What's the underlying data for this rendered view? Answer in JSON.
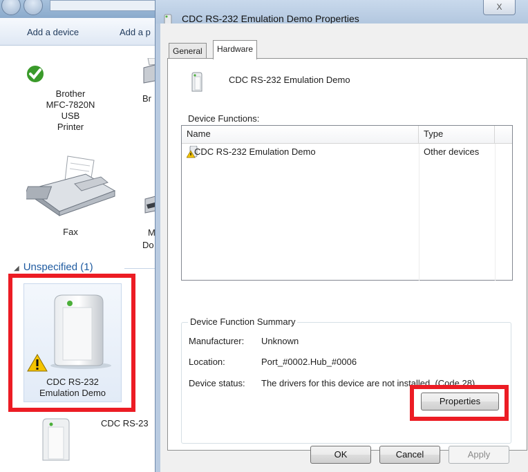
{
  "explorer": {
    "toolbar": {
      "add_device": "Add a device",
      "add_printer_partial": "Add a p"
    },
    "devices": [
      {
        "name_line1": "Brother",
        "name_line2": "MFC-7820N USB",
        "name_line3": "Printer"
      },
      {
        "name_partial": "Br"
      },
      {
        "name": "Fax"
      },
      {
        "name_partial_1": "M",
        "name_partial_2": "Do"
      }
    ],
    "section": {
      "label": "Unspecified (1)"
    },
    "selected_device": {
      "line1": "CDC RS-232",
      "line2": "Emulation Demo"
    },
    "next_device_partial": "CDC RS-23"
  },
  "dialog": {
    "title": "CDC RS-232 Emulation Demo Properties",
    "close_label": "X",
    "tabs": [
      {
        "label": "General"
      },
      {
        "label": "Hardware"
      }
    ],
    "device_name": "CDC RS-232 Emulation Demo",
    "functions_label": "Device Functions:",
    "table": {
      "columns": [
        "Name",
        "Type"
      ],
      "rows": [
        {
          "name": "CDC RS-232 Emulation Demo",
          "type": "Other devices"
        }
      ]
    },
    "summary": {
      "legend": "Device Function Summary",
      "manufacturer_label": "Manufacturer:",
      "manufacturer_value": "Unknown",
      "location_label": "Location:",
      "location_value": "Port_#0002.Hub_#0006",
      "status_label": "Device status:",
      "status_value": "The drivers for this device are not installed. (Code 28)"
    },
    "properties_button": "Properties",
    "buttons": {
      "ok": "OK",
      "cancel": "Cancel",
      "apply": "Apply"
    }
  },
  "colors": {
    "highlight_box": "#ec1c24",
    "link_blue": "#1e5aa0",
    "window_frame": "#b9cbe1"
  }
}
